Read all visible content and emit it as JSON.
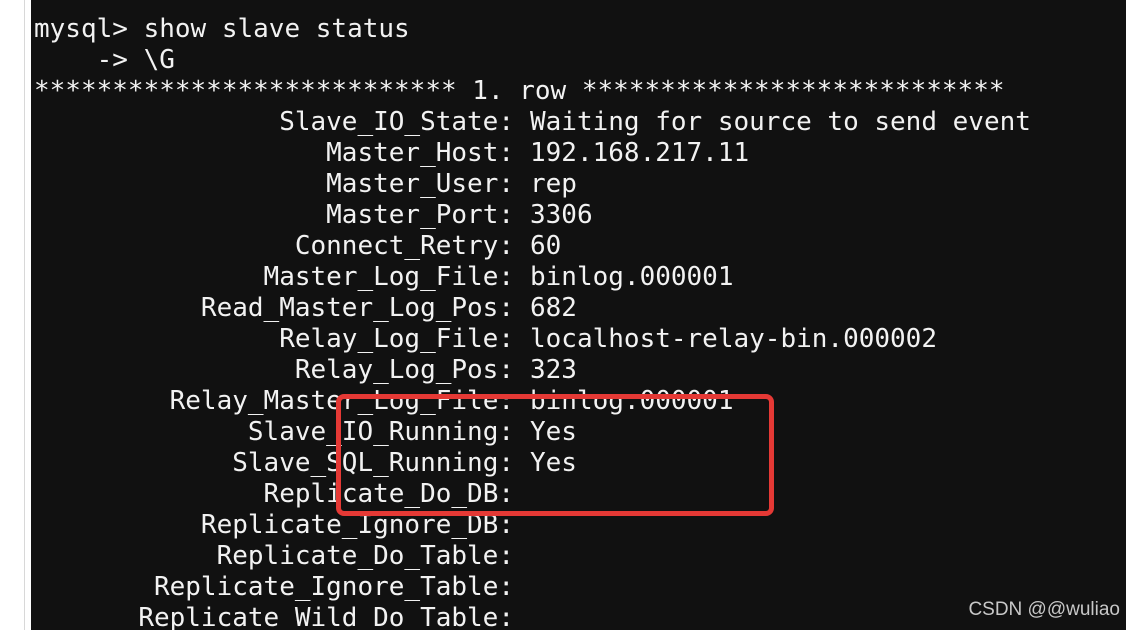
{
  "prompt_line": "mysql> show slave status",
  "continuation_line": "    -> \\G",
  "row_header": "*************************** 1. row ***************************",
  "fields": [
    {
      "label": "Slave_IO_State:",
      "value": "Waiting for source to send event",
      "style": "normal"
    },
    {
      "label": "Master_Host:",
      "value": "192.168.217.11",
      "style": "ip"
    },
    {
      "label": "Master_User:",
      "value": "rep",
      "style": "normal"
    },
    {
      "label": "Master_Port:",
      "value": "3306",
      "style": "normal"
    },
    {
      "label": "Connect_Retry:",
      "value": "60",
      "style": "normal"
    },
    {
      "label": "Master_Log_File:",
      "value": "binlog.000001",
      "style": "normal"
    },
    {
      "label": "Read_Master_Log_Pos:",
      "value": "682",
      "style": "normal"
    },
    {
      "label": "Relay_Log_File:",
      "value": "localhost-relay-bin.000002",
      "style": "normal"
    },
    {
      "label": "Relay_Log_Pos:",
      "value": "323",
      "style": "normal"
    },
    {
      "label": "Relay_Master_Log_File:",
      "value": "binlog.000001",
      "style": "normal"
    },
    {
      "label": "Slave_IO_Running:",
      "value": "Yes",
      "style": "yes"
    },
    {
      "label": "Slave_SQL_Running:",
      "value": "Yes",
      "style": "yes"
    },
    {
      "label": "Replicate_Do_DB:",
      "value": "",
      "style": "normal"
    },
    {
      "label": "Replicate_Ignore_DB:",
      "value": "",
      "style": "normal"
    },
    {
      "label": "Replicate_Do_Table:",
      "value": "",
      "style": "normal"
    },
    {
      "label": "Replicate_Ignore_Table:",
      "value": "",
      "style": "normal"
    },
    {
      "label": "Replicate_Wild_Do_Table:",
      "value": "",
      "style": "normal"
    }
  ],
  "watermark": "CSDN @@wuliao",
  "colors": {
    "background": "#111111",
    "text": "#f2f2f2",
    "ip_value": "#ff40ff",
    "yes_value": "#22e07a",
    "highlight_border": "#e53935"
  }
}
